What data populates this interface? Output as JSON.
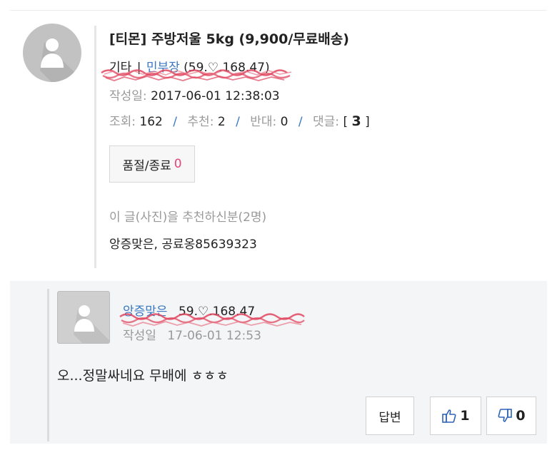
{
  "post": {
    "title": "[티몬] 주방저울 5kg (9,900/무료배송)",
    "category": "기타",
    "sep": "|",
    "author": "민부장",
    "ip": "(59.♡.168.47)",
    "date_label": "작성일:",
    "date": "2017-06-01 12:38:03",
    "views_label": "조회:",
    "views": "162",
    "recommend_label": "추천:",
    "recommend": "2",
    "oppose_label": "반대:",
    "oppose": "0",
    "comments_label": "댓글:",
    "comments_open": "[",
    "comments": "3",
    "comments_close": "]",
    "slash": "/",
    "soldout_label": "품절/종료",
    "soldout_count": "0",
    "recommenders_label": "이 글(사진)을 추천하신분(2명)",
    "recommenders": "앙증맞은, 공료옹85639323"
  },
  "comment": {
    "author": "앙증맞은",
    "ip": "59.♡.168.47",
    "date_label": "작성일",
    "date": "17-06-01 12:53",
    "text": "오...정말싸네요 무배에 ㅎㅎㅎ",
    "reply_label": "답변",
    "like_count": "1",
    "dislike_count": "0"
  },
  "icons": {
    "avatar": "user-avatar-icon",
    "like": "thumbs-up-icon",
    "dislike": "thumbs-down-icon"
  },
  "colors": {
    "link_blue": "#3a78c3",
    "count_pink": "#e0457b",
    "comment_bg": "#f4f5f6",
    "scribble_red": "#e0455f"
  }
}
